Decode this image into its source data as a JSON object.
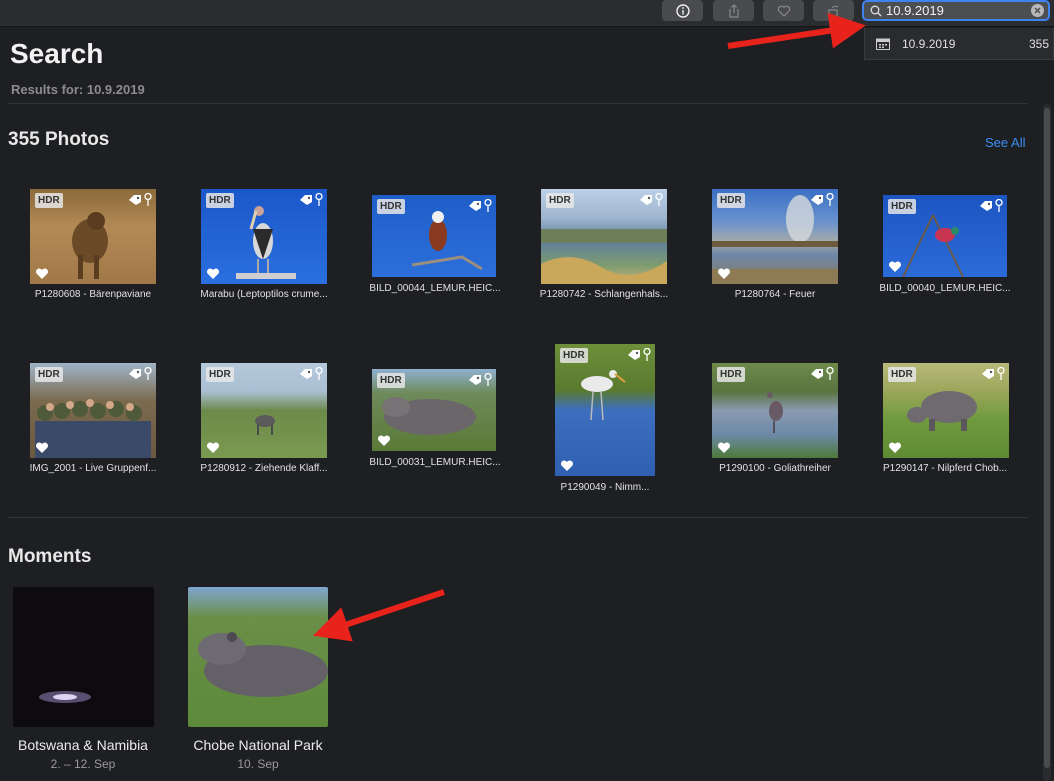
{
  "search": {
    "value": "10.9.2019",
    "placeholder": "Search"
  },
  "suggestion": {
    "label": "10.9.2019",
    "count": "355"
  },
  "header": {
    "title": "Search",
    "subtitle": "Results for: 10.9.2019"
  },
  "photos_section": {
    "title": "355 Photos",
    "see_all": "See All"
  },
  "photos": [
    {
      "caption": "P1280608 - Bärenpaviane",
      "hdr": "HDR"
    },
    {
      "caption": "Marabu (Leptoptilos crume...",
      "hdr": "HDR"
    },
    {
      "caption": "BILD_00044_LEMUR.HEIC...",
      "hdr": "HDR"
    },
    {
      "caption": "P1280742 - Schlangenhals...",
      "hdr": "HDR"
    },
    {
      "caption": "P1280764 - Feuer",
      "hdr": "HDR"
    },
    {
      "caption": "BILD_00040_LEMUR.HEIC...",
      "hdr": "HDR"
    },
    {
      "caption": "IMG_2001 - Live Gruppenf...",
      "hdr": "HDR"
    },
    {
      "caption": "P1280912 - Ziehende Klaff...",
      "hdr": "HDR"
    },
    {
      "caption": "BILD_00031_LEMUR.HEIC...",
      "hdr": "HDR"
    },
    {
      "caption": "P1290049 - Nimm...",
      "hdr": "HDR"
    },
    {
      "caption": "P1290100 - Goliathreiher",
      "hdr": "HDR"
    },
    {
      "caption": "P1290147 -  Nilpferd Chob...",
      "hdr": "HDR"
    }
  ],
  "moments_section": {
    "title": "Moments"
  },
  "moments": [
    {
      "title": "Botswana & Namibia",
      "date": "2. – 12. Sep"
    },
    {
      "title": "Chobe National Park",
      "date": "10. Sep"
    }
  ],
  "colors": {
    "accent": "#3a8ff2",
    "annotation_arrow": "#e8231b",
    "background": "#1e1f22"
  }
}
